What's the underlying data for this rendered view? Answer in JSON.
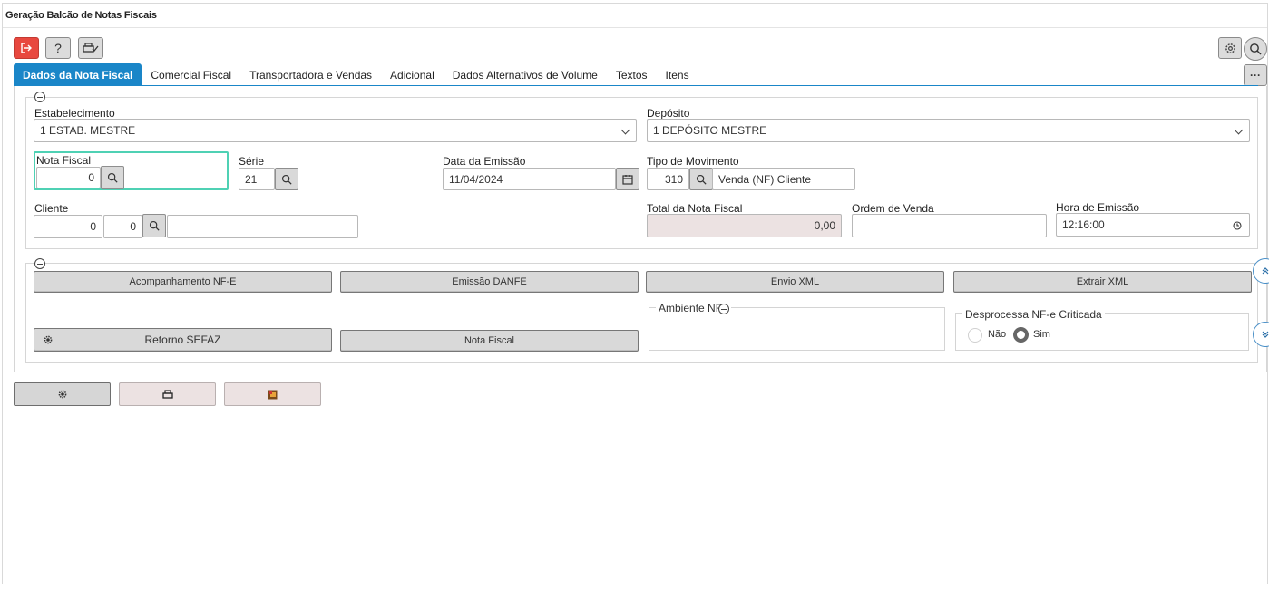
{
  "window": {
    "title": "Geração Balcão de Notas Fiscais"
  },
  "toolbar": {
    "exit_icon": "exit-icon",
    "help_label": "?",
    "print_icon": "printer-check-icon",
    "settings_icon": "gear-icon",
    "search_icon": "search-icon",
    "more_label": "···"
  },
  "tabs": [
    {
      "label": "Dados da Nota Fiscal",
      "active": true
    },
    {
      "label": "Comercial Fiscal"
    },
    {
      "label": "Transportadora e Vendas"
    },
    {
      "label": "Adicional"
    },
    {
      "label": "Dados Alternativos de Volume"
    },
    {
      "label": "Textos"
    },
    {
      "label": "Itens"
    }
  ],
  "form": {
    "estabelecimento": {
      "label": "Estabelecimento",
      "value": "1 ESTAB. MESTRE"
    },
    "deposito": {
      "label": "Depósito",
      "value": "1 DEPÓSITO MESTRE"
    },
    "nota_fiscal": {
      "label": "Nota Fiscal",
      "value": "0"
    },
    "serie": {
      "label": "Série",
      "value": "21"
    },
    "data_emissao": {
      "label": "Data da Emissão",
      "value": "11/04/2024"
    },
    "tipo_movimento": {
      "label": "Tipo de Movimento",
      "code": "310",
      "desc": "Venda (NF) Cliente"
    },
    "cliente": {
      "label": "Cliente",
      "code1": "0",
      "code2": "0",
      "name": ""
    },
    "total_nota": {
      "label": "Total da Nota Fiscal",
      "value": "0,00"
    },
    "ordem_venda": {
      "label": "Ordem de Venda",
      "value": ""
    },
    "hora_emissao": {
      "label": "Hora de Emissão",
      "value": "12:16:00"
    }
  },
  "actions": {
    "acompanhamento": "Acompanhamento NF-E",
    "emissao_danfe": "Emissão DANFE",
    "envio_xml": "Envio XML",
    "extrair_xml": "Extrair XML",
    "retorno_sefaz": "Retorno SEFAZ",
    "nota_fiscal": "Nota Fiscal"
  },
  "ambiente": {
    "legend": "Ambiente NFe"
  },
  "desprocessa": {
    "legend": "Desprocessa NF-e Criticada",
    "options": [
      {
        "label": "Não",
        "selected": false
      },
      {
        "label": "Sim",
        "selected": true
      }
    ]
  },
  "colors": {
    "accent": "#1a86c8",
    "exit": "#e8483f",
    "focus": "#4fd1b4",
    "readonly": "#ece2e2"
  }
}
